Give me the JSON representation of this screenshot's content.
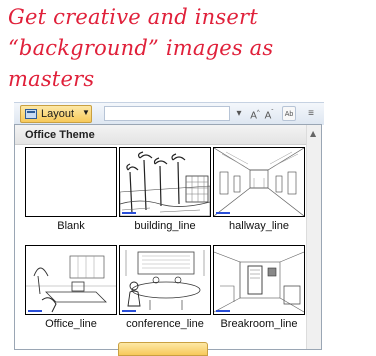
{
  "annotation": {
    "lines": [
      "Get creative and insert",
      "“background” images as",
      "masters"
    ],
    "color": "#e0203a"
  },
  "ribbon": {
    "layout_button_label": "Layout",
    "layout_icon": "layout-icon",
    "dropdown_icon": "chevron-down-icon"
  },
  "gallery": {
    "section_title": "Office Theme",
    "items": [
      {
        "label": "Blank"
      },
      {
        "label": "building_line"
      },
      {
        "label": "hallway_line"
      },
      {
        "label": "Office_line"
      },
      {
        "label": "conference_line"
      },
      {
        "label": "Breakroom_line"
      }
    ]
  }
}
